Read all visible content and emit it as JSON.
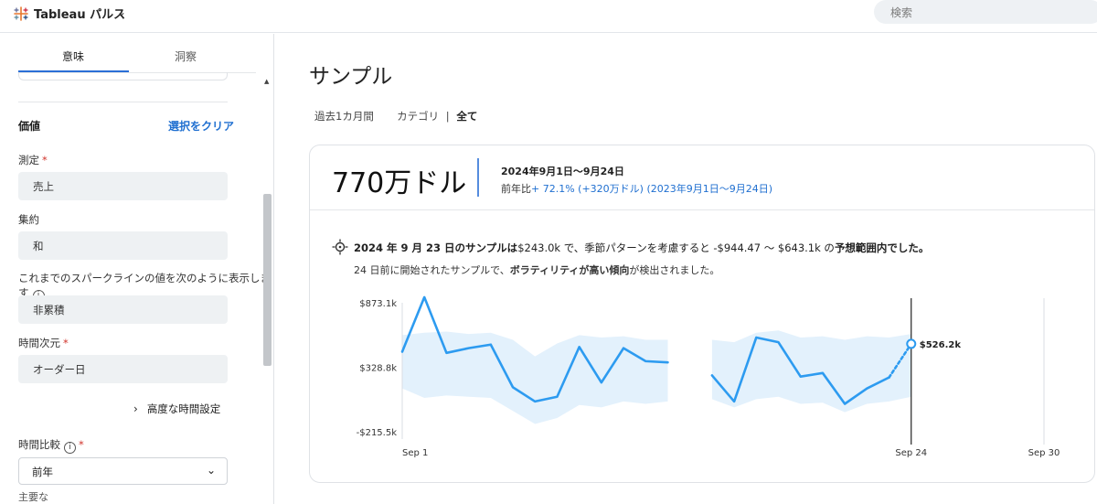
{
  "header": {
    "app_title": "Tableau パルス",
    "search_placeholder": "検索"
  },
  "sidebar": {
    "tabs": [
      {
        "label": "意味",
        "active": true
      },
      {
        "label": "洞察",
        "active": false
      }
    ],
    "section_title": "価値",
    "clear_selection": "選択をクリア",
    "fields": [
      {
        "label": "測定",
        "required": true,
        "value": "売上"
      },
      {
        "label": "集約",
        "required": false,
        "value": "和"
      },
      {
        "label": "これまでのスパークラインの値を次のように表示します",
        "required": false,
        "info": true,
        "value": "非累積"
      },
      {
        "label": "時間次元",
        "required": true,
        "value": "オーダー日"
      }
    ],
    "advanced_link": "高度な時間設定",
    "time_comparison": {
      "label": "時間比較",
      "required": true,
      "info": true,
      "value": "前年"
    },
    "cutoff_label": "主要な"
  },
  "main": {
    "title": "サンプル",
    "filters": {
      "period": "過去1カ月間",
      "category_label": "カテゴリ",
      "separator": "|",
      "category_value": "全て"
    },
    "card": {
      "big_value": "770万ドル",
      "date_range": "2024年9月1日〜9月24日",
      "comparison_prefix": "前年比",
      "comparison_value": "+ 72.1% (+320万ドル) (2023年9月1日〜9月24日)",
      "insight_line1_a": "2024 年 9 月 23 日のサンプルは",
      "insight_line1_b": "$243.0k で、季節パターンを考慮すると -$944.47 〜 $643.1k の",
      "insight_line1_c": "予想範囲内でした。",
      "insight_line2_a": "24 日前に開始されたサンプルで、",
      "insight_line2_b": "ボラティリティが高い傾向",
      "insight_line2_c": "が検出されました。"
    }
  },
  "colors": {
    "accent": "#2b6fd6",
    "line": "#2d9bf0",
    "band": "#e3f1fc"
  },
  "chart_data": {
    "type": "line",
    "y_tick_labels": [
      "$873.1k",
      "$328.8k",
      "-$215.5k"
    ],
    "y_ticks": [
      873.1,
      328.8,
      -215.5
    ],
    "x_tick_labels": [
      "Sep 1",
      "Sep 24",
      "Sep 30"
    ],
    "x_ticks": [
      1,
      24,
      30
    ],
    "xlim": [
      1,
      30
    ],
    "ylim": [
      -215.5,
      873.1
    ],
    "last_label": "$526.2k",
    "series": [
      {
        "style": "solid",
        "x": [
          1,
          2,
          3,
          4,
          5,
          6,
          7,
          8,
          9,
          10,
          11,
          12,
          13
        ],
        "y": [
          460,
          920,
          450,
          490,
          520,
          160,
          40,
          80,
          500,
          200,
          490,
          380,
          370
        ]
      },
      {
        "style": "solid",
        "x": [
          15,
          16,
          17,
          18,
          19,
          20,
          21,
          22,
          23
        ],
        "y": [
          260,
          40,
          580,
          540,
          250,
          280,
          20,
          150,
          243
        ]
      },
      {
        "style": "dashed",
        "x": [
          23,
          24
        ],
        "y": [
          243,
          526.2
        ]
      }
    ],
    "expected_range": {
      "segments": [
        {
          "x": [
            1,
            2,
            3,
            4,
            5,
            6,
            7,
            8,
            9,
            10,
            11,
            12,
            13
          ],
          "upper": [
            600,
            620,
            630,
            610,
            620,
            560,
            420,
            530,
            600,
            580,
            590,
            560,
            560
          ],
          "lower": [
            150,
            70,
            90,
            80,
            70,
            -40,
            -150,
            -100,
            10,
            -10,
            40,
            20,
            40
          ]
        },
        {
          "x": [
            15,
            16,
            17,
            18,
            19,
            20,
            21,
            22,
            23,
            24
          ],
          "upper": [
            560,
            540,
            620,
            640,
            580,
            590,
            560,
            590,
            580,
            610
          ],
          "lower": [
            60,
            -10,
            60,
            80,
            20,
            30,
            -50,
            20,
            40,
            80
          ]
        }
      ]
    },
    "highlight_x": 24,
    "grid": false
  }
}
